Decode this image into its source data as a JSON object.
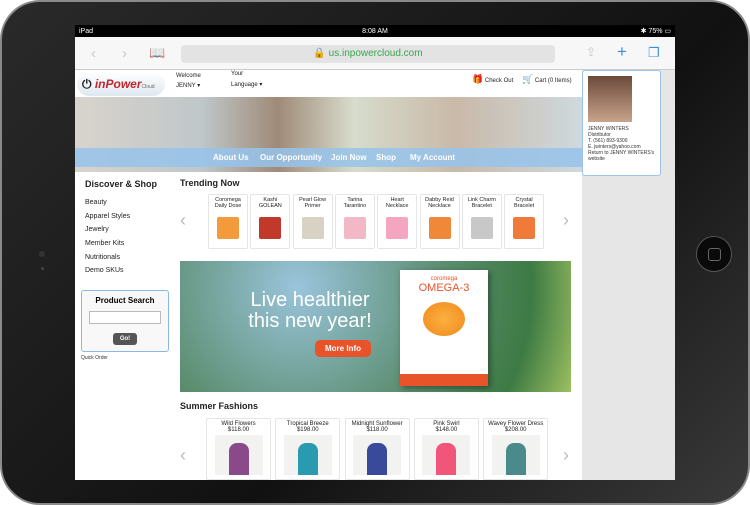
{
  "device": {
    "status": {
      "device": "iPad",
      "time": "8:08 AM",
      "battery": "75%"
    }
  },
  "browser": {
    "url": "us.inpowercloud.com",
    "icons": [
      "back-icon",
      "forward-icon",
      "bookmarks-icon",
      "lock-icon",
      "share-icon",
      "new-tab-icon",
      "tabs-icon"
    ]
  },
  "header": {
    "logo_text": "inPower",
    "logo_sub": "Cloud",
    "welcome": "Welcome",
    "user": "JENNY",
    "language_1": "Your",
    "language_2": "Language",
    "checkout": "Check Out",
    "cart": "Cart (0 Items)"
  },
  "nav": [
    "About Us",
    "Our Opportunity",
    "Join Now",
    "Shop",
    "My Account"
  ],
  "sidebar": {
    "title": "Discover & Shop",
    "items": [
      "Beauty",
      "Apparel Styles",
      "Jewelry",
      "Member Kits",
      "Nutritionals",
      "Demo SKUs"
    ],
    "search_title": "Product Search",
    "search_value": "",
    "go": "Go!",
    "quick_order": "Quick Order"
  },
  "trending": {
    "title": "Trending Now",
    "items": [
      {
        "name": "Coromega Daily Dose",
        "color": "#f39a3a"
      },
      {
        "name": "Kashi GOLEAN",
        "color": "#c0392b"
      },
      {
        "name": "Pearl Glow Primer",
        "color": "#d8d2c4"
      },
      {
        "name": "Tarina Tarantino",
        "color": "#f2b8c6"
      },
      {
        "name": "Heart Necklace",
        "color": "#f4a6c0"
      },
      {
        "name": "Dabby Reid Necklace",
        "color": "#f0883a"
      },
      {
        "name": "Link Charm Bracelet",
        "color": "#c8c8c8"
      },
      {
        "name": "Crystal Bracelet",
        "color": "#f07a3a"
      }
    ]
  },
  "banner": {
    "line1": "Live healthier",
    "line2": "this new year!",
    "button": "More Info",
    "product_brand": "coromega",
    "product_name": "OMEGA-3"
  },
  "summer": {
    "title": "Summer Fashions",
    "items": [
      {
        "name": "Wild Flowers",
        "price": "$118.00",
        "color": "#8a4a8a"
      },
      {
        "name": "Tropical Breeze",
        "price": "$198.00",
        "color": "#2a9ab0"
      },
      {
        "name": "Midnight Sunflower",
        "price": "$118.00",
        "color": "#3a4a9a"
      },
      {
        "name": "Pink Swirl",
        "price": "$148.00",
        "color": "#f2557a"
      },
      {
        "name": "Wavey Flower Dress",
        "price": "$208.00",
        "color": "#4a8a8a"
      }
    ]
  },
  "distributor": {
    "name": "JENNY WINTERS",
    "role": "Distributor",
    "phone_label": "T.",
    "phone": "(561) 893-9300",
    "email_label": "E.",
    "email": "jwinters@yahoo.com",
    "return_link": "Return to JENNY WINTERS's website"
  }
}
